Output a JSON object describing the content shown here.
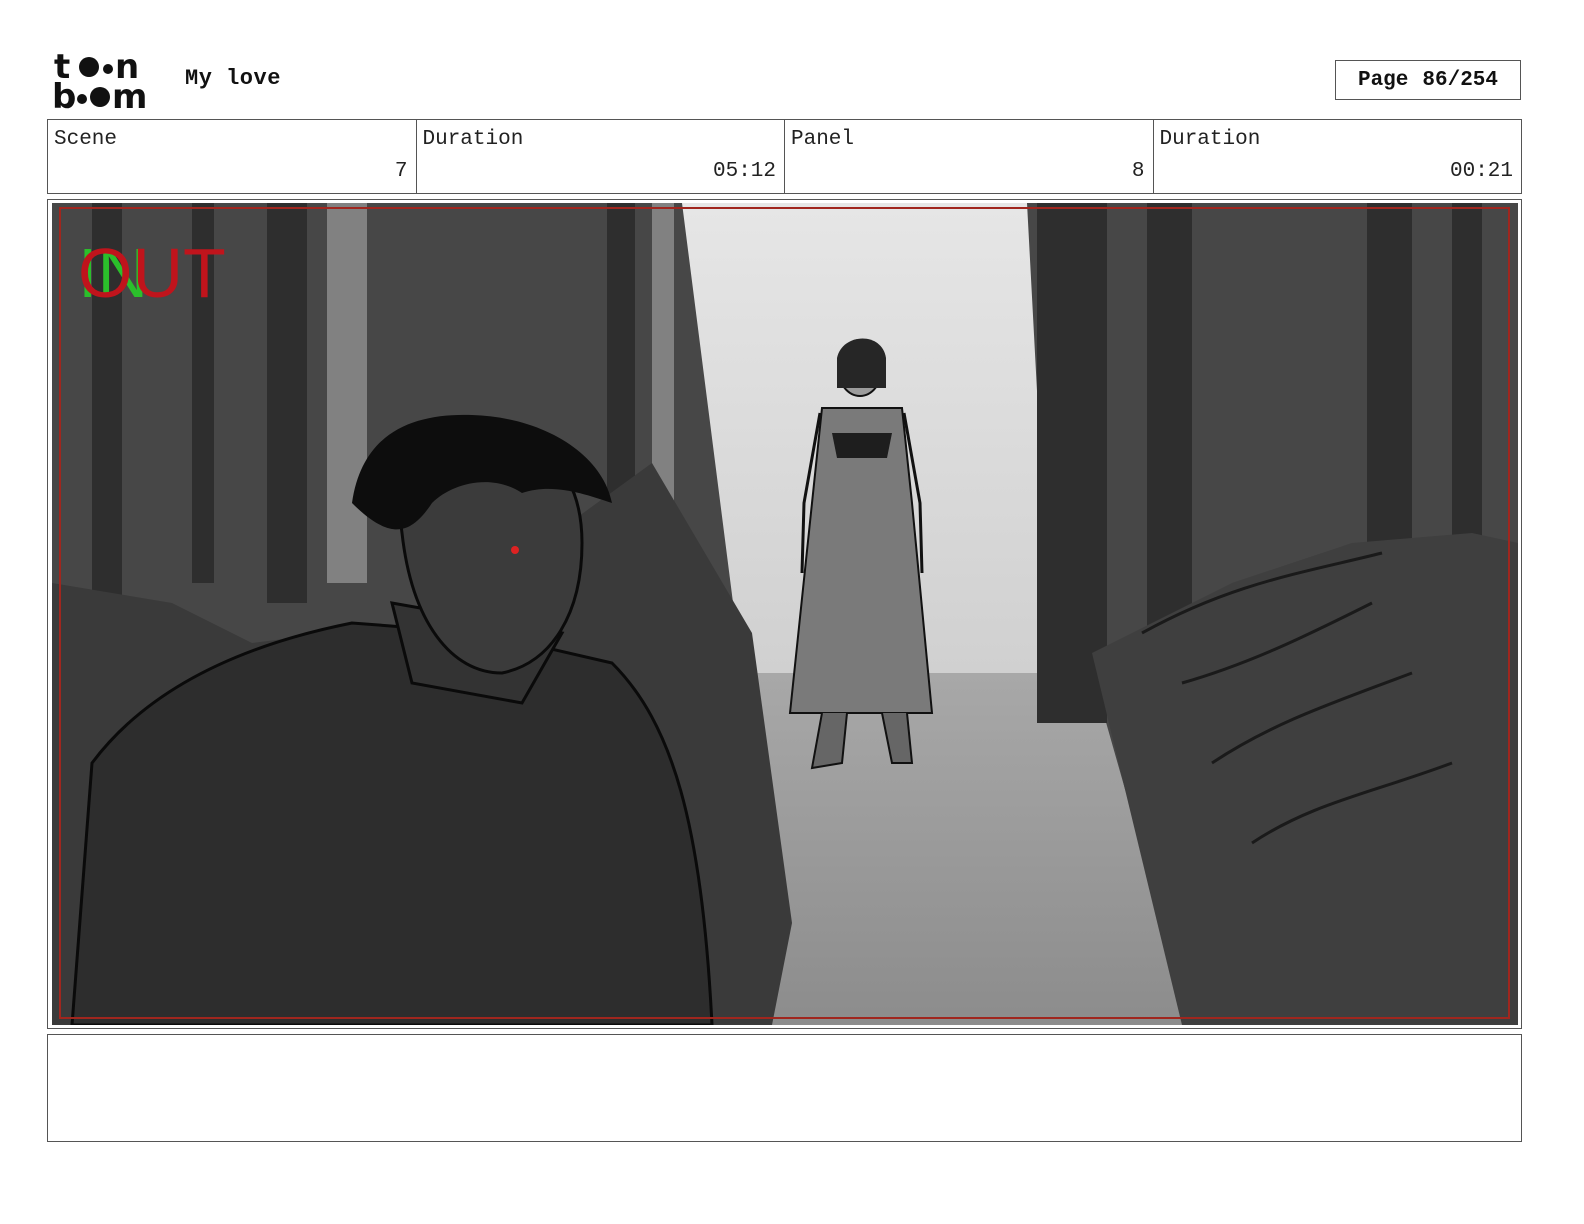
{
  "header": {
    "logo": {
      "line1": "toon",
      "line2": "boom"
    },
    "project_title": "My love",
    "page": {
      "label": "Page",
      "value": "86/254"
    }
  },
  "info": {
    "scene_label": "Scene",
    "scene_value": "7",
    "scene_duration_label": "Duration",
    "scene_duration_value": "05:12",
    "panel_label": "Panel",
    "panel_value": "8",
    "panel_duration_label": "Duration",
    "panel_duration_value": "00:21"
  },
  "panel": {
    "in_marker": "IN",
    "out_marker": "OUT",
    "colors": {
      "in_marker": "#2bbf2b",
      "out_marker": "#c0141c",
      "safe_frame": "#a0261e"
    }
  },
  "notes": {
    "text": ""
  }
}
